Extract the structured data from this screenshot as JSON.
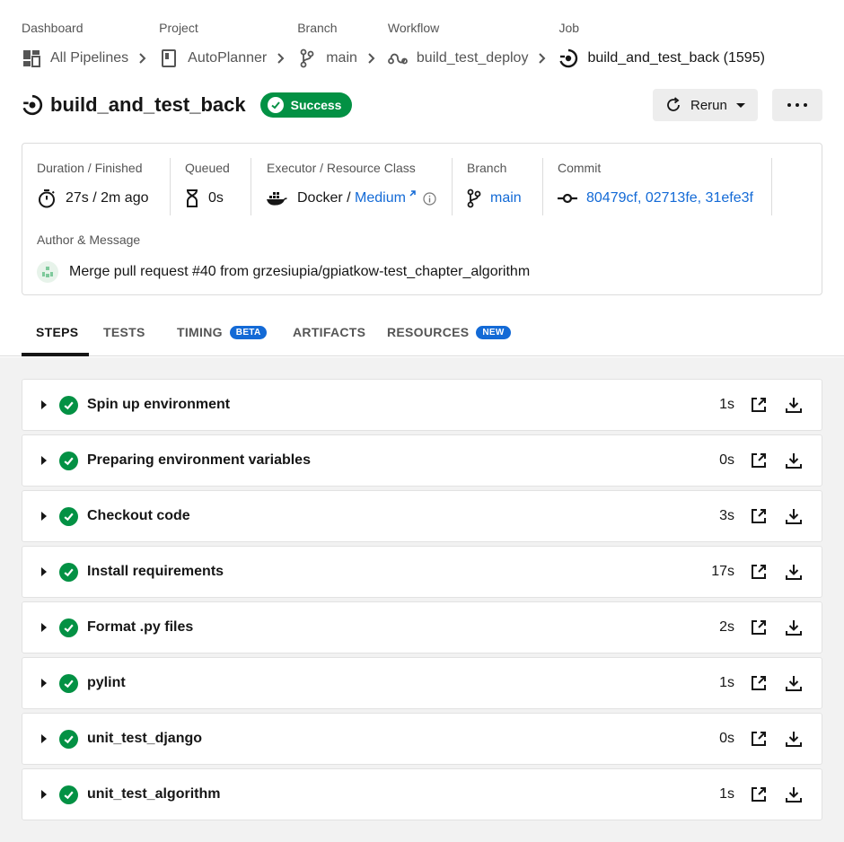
{
  "breadcrumb": {
    "dashboard": {
      "label": "Dashboard",
      "value": "All Pipelines"
    },
    "project": {
      "label": "Project",
      "value": "AutoPlanner"
    },
    "branch": {
      "label": "Branch",
      "value": "main"
    },
    "workflow": {
      "label": "Workflow",
      "value": "build_test_deploy"
    },
    "job": {
      "label": "Job",
      "value": "build_and_test_back (1595)"
    }
  },
  "header": {
    "title": "build_and_test_back",
    "status": "Success",
    "rerun_label": "Rerun"
  },
  "info": {
    "duration": {
      "label": "Duration / Finished",
      "value": "27s / 2m ago"
    },
    "queued": {
      "label": "Queued",
      "value": "0s"
    },
    "executor": {
      "label": "Executor / Resource Class",
      "executor": "Docker / ",
      "resource_class": "Medium"
    },
    "branch": {
      "label": "Branch",
      "value": "main"
    },
    "commit": {
      "label": "Commit",
      "value": "80479cf, 02713fe, 31efe3f"
    },
    "author": {
      "label": "Author & Message",
      "message": "Merge pull request #40 from grzesiupia/gpiatkow-test_chapter_algorithm"
    }
  },
  "tabs": [
    {
      "label": "STEPS",
      "active": true
    },
    {
      "label": "TESTS"
    },
    {
      "label": "TIMING",
      "pill": "BETA"
    },
    {
      "label": "ARTIFACTS"
    },
    {
      "label": "RESOURCES",
      "pill": "NEW"
    }
  ],
  "steps": [
    {
      "name": "Spin up environment",
      "duration": "1s"
    },
    {
      "name": "Preparing environment variables",
      "duration": "0s"
    },
    {
      "name": "Checkout code",
      "duration": "3s"
    },
    {
      "name": "Install requirements",
      "duration": "17s"
    },
    {
      "name": "Format .py files",
      "duration": "2s"
    },
    {
      "name": "pylint",
      "duration": "1s"
    },
    {
      "name": "unit_test_django",
      "duration": "0s"
    },
    {
      "name": "unit_test_algorithm",
      "duration": "1s"
    }
  ],
  "colors": {
    "success": "#039144",
    "link": "#136ad6",
    "pill": "#136ad6"
  }
}
